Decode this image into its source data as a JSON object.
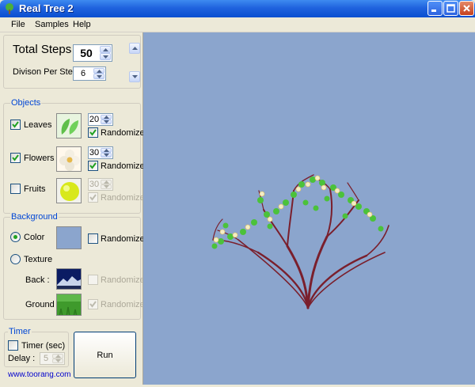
{
  "window": {
    "title": "Real Tree 2",
    "icon": "tree-icon"
  },
  "menu": {
    "items": [
      "File",
      "Samples",
      "Help"
    ]
  },
  "steps": {
    "total_label": "Total Steps",
    "total_value": "50",
    "division_label": "Divison Per Step",
    "division_value": "6"
  },
  "objects": {
    "title": "Objects",
    "leaves": {
      "label": "Leaves",
      "checked": true,
      "count": "20",
      "randomize_label": "Randomize",
      "randomize": true,
      "enabled": true
    },
    "flowers": {
      "label": "Flowers",
      "checked": true,
      "count": "30",
      "randomize_label": "Randomize",
      "randomize": true,
      "enabled": true
    },
    "fruits": {
      "label": "Fruits",
      "checked": false,
      "count": "30",
      "randomize_label": "Randomize",
      "randomize": true,
      "enabled": false
    }
  },
  "background": {
    "title": "Background",
    "color_label": "Color",
    "color_selected": true,
    "color_value": "#8ba5cd",
    "color_randomize_label": "Randomize",
    "texture_label": "Texture",
    "back_label": "Back :",
    "back_randomize_label": "Randomize",
    "ground_label": "Ground :",
    "ground_randomize_label": "Randomize"
  },
  "timer": {
    "title": "Timer",
    "timer_label": "Timer (sec)",
    "delay_label": "Delay :",
    "delay_value": "5"
  },
  "run_label": "Run",
  "website": "www.toorang.com",
  "colors": {
    "group_title": "#0046d5",
    "canvas_bg": "#8ba5cd"
  }
}
